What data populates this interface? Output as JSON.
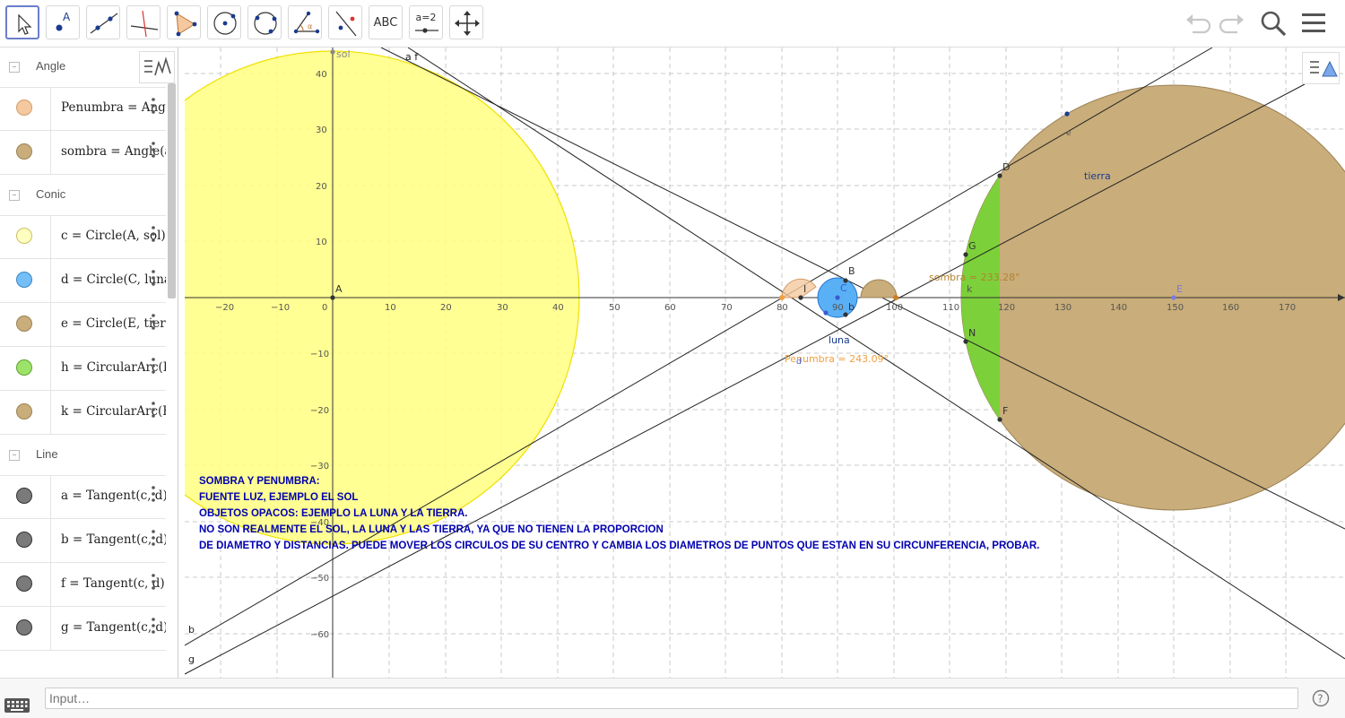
{
  "toolbar": {
    "tools": [
      {
        "name": "move-tool",
        "label": ""
      },
      {
        "name": "point-tool",
        "label": "A"
      },
      {
        "name": "line-tool",
        "label": ""
      },
      {
        "name": "perpendicular-tool",
        "label": ""
      },
      {
        "name": "polygon-tool",
        "label": ""
      },
      {
        "name": "circle-center-point-tool",
        "label": ""
      },
      {
        "name": "circle-three-points-tool",
        "label": ""
      },
      {
        "name": "angle-tool",
        "label": ""
      },
      {
        "name": "reflect-tool",
        "label": ""
      },
      {
        "name": "text-tool",
        "label": "ABC"
      },
      {
        "name": "slider-tool",
        "label": "a=2"
      },
      {
        "name": "move-graphics-tool",
        "label": ""
      }
    ]
  },
  "input": {
    "placeholder": "Input…"
  },
  "algebra": {
    "groups": [
      {
        "label": "Angle",
        "items": [
          {
            "def": "Penumbra = Angle(",
            "color": "#f4c9a0"
          },
          {
            "def": "sombra = Angle(a,",
            "color": "#c9ad7a"
          }
        ]
      },
      {
        "label": "Conic",
        "items": [
          {
            "def": "c = Circle(A, sol)",
            "color": "#ffffb0"
          },
          {
            "def": "d = Circle(C, luna)",
            "color": "#74bff7"
          },
          {
            "def": "e = Circle(E, tierra)",
            "color": "#c9ad7a"
          },
          {
            "def": "h = CircularArc(E,",
            "color": "#9de36a"
          },
          {
            "def": "k = CircularArc(E,",
            "color": "#c9ad7a"
          }
        ]
      },
      {
        "label": "Line",
        "items": [
          {
            "def": "a = Tangent(c, d)",
            "color": "#7a7a7a"
          },
          {
            "def": "b = Tangent(c, d)",
            "color": "#7a7a7a"
          },
          {
            "def": "f = Tangent(c, d)",
            "color": "#7a7a7a"
          },
          {
            "def": "g = Tangent(c, d)",
            "color": "#7a7a7a"
          }
        ]
      }
    ]
  },
  "graphics": {
    "x_ticks": [
      "−20",
      "−10",
      "0",
      "10",
      "20",
      "30",
      "40",
      "50",
      "60",
      "70",
      "80",
      "90",
      "100",
      "110",
      "120",
      "130",
      "140",
      "150",
      "160",
      "170"
    ],
    "y_ticks": [
      "40",
      "30",
      "20",
      "10",
      "−10",
      "−20",
      "−30",
      "−40",
      "−50",
      "−60"
    ],
    "labels": {
      "sol": "sol",
      "A": "A",
      "af": "a f",
      "B": "B",
      "C": "C",
      "b_small": "b",
      "I": "I",
      "luna": "luna",
      "D": "D",
      "G": "G",
      "k": "k",
      "N": "N",
      "F": "F",
      "E": "E",
      "e": "e",
      "tierra": "tierra",
      "line_b": "b",
      "line_g": "g",
      "d_small": "d"
    },
    "angle_labels": {
      "sombra": "sombra = 233.28°",
      "penumbra": "Penumbra = 243.09°"
    },
    "description": [
      "SOMBRA Y PENUMBRA:",
      "FUENTE LUZ, EJEMPLO EL SOL",
      "OBJETOS OPACOS: EJEMPLO  LA LUNA Y  LA TIERRA.",
      "NO SON REALMENTE EL SOL, LA LUNA Y LAS TIERRA, YA QUE  NO TIENEN LA PROPORCION",
      "DE DIAMETRO Y DISTANCIAS. PUEDE MOVER LOS CIRCULOS DE SU CENTRO Y CAMBIA LOS DIAMETROS  DE PUNTOS  QUE ESTAN EN SU CIRCUNFERENCIA, PROBAR."
    ],
    "colors": {
      "sun": "#ffff80",
      "sun_stroke": "#f0e000",
      "moon": "#5ab0f5",
      "earth": "#c9ad7a",
      "shadow_arc": "#7cd13a",
      "penumbra": "#f4c9a0",
      "axis_text": "#555",
      "desc_text": "#0000b0",
      "angle_text": "#b5822e",
      "penumbra_text": "#f0a040"
    }
  }
}
